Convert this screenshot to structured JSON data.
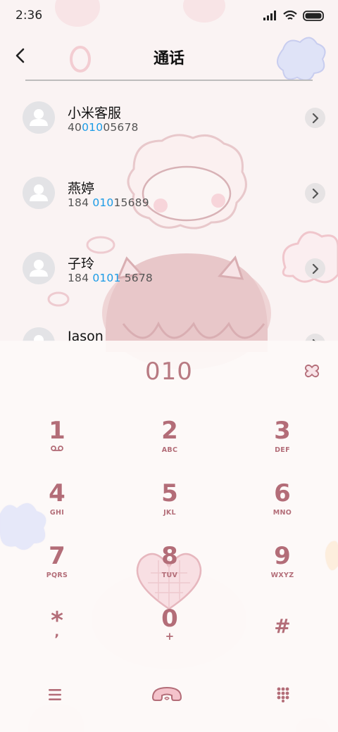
{
  "status_bar": {
    "time": "2:36"
  },
  "header": {
    "title": "通话"
  },
  "contacts": [
    {
      "name": "小米客服",
      "number_parts": [
        "40",
        "010",
        "05678"
      ]
    },
    {
      "name": "燕婷",
      "number_parts": [
        "184 ",
        "010",
        "15689"
      ]
    },
    {
      "name": "子玲",
      "number_parts": [
        "184 ",
        "0101",
        " 5678"
      ]
    },
    {
      "name": "Jason",
      "number_parts": [
        "",
        "",
        ""
      ]
    }
  ],
  "dialer": {
    "dialed_number": "010",
    "keys": [
      {
        "digit": "1",
        "letters": "oo"
      },
      {
        "digit": "2",
        "letters": "ABC"
      },
      {
        "digit": "3",
        "letters": "DEF"
      },
      {
        "digit": "4",
        "letters": "GHI"
      },
      {
        "digit": "5",
        "letters": "JKL"
      },
      {
        "digit": "6",
        "letters": "MNO"
      },
      {
        "digit": "7",
        "letters": "PQRS"
      },
      {
        "digit": "8",
        "letters": "TUV"
      },
      {
        "digit": "9",
        "letters": "WXYZ"
      },
      {
        "digit": "*",
        "letters": ","
      },
      {
        "digit": "0",
        "letters": "+"
      },
      {
        "digit": "#",
        "letters": ""
      }
    ]
  },
  "colors": {
    "accent_pink": "#b36d78",
    "highlight_blue": "#1a9be6",
    "background": "#faf3f3"
  },
  "icons": {
    "back": "chevron-left-icon",
    "menu": "menu-icon",
    "call": "phone-call-icon",
    "keypad": "keypad-icon",
    "clear": "clear-icon"
  }
}
